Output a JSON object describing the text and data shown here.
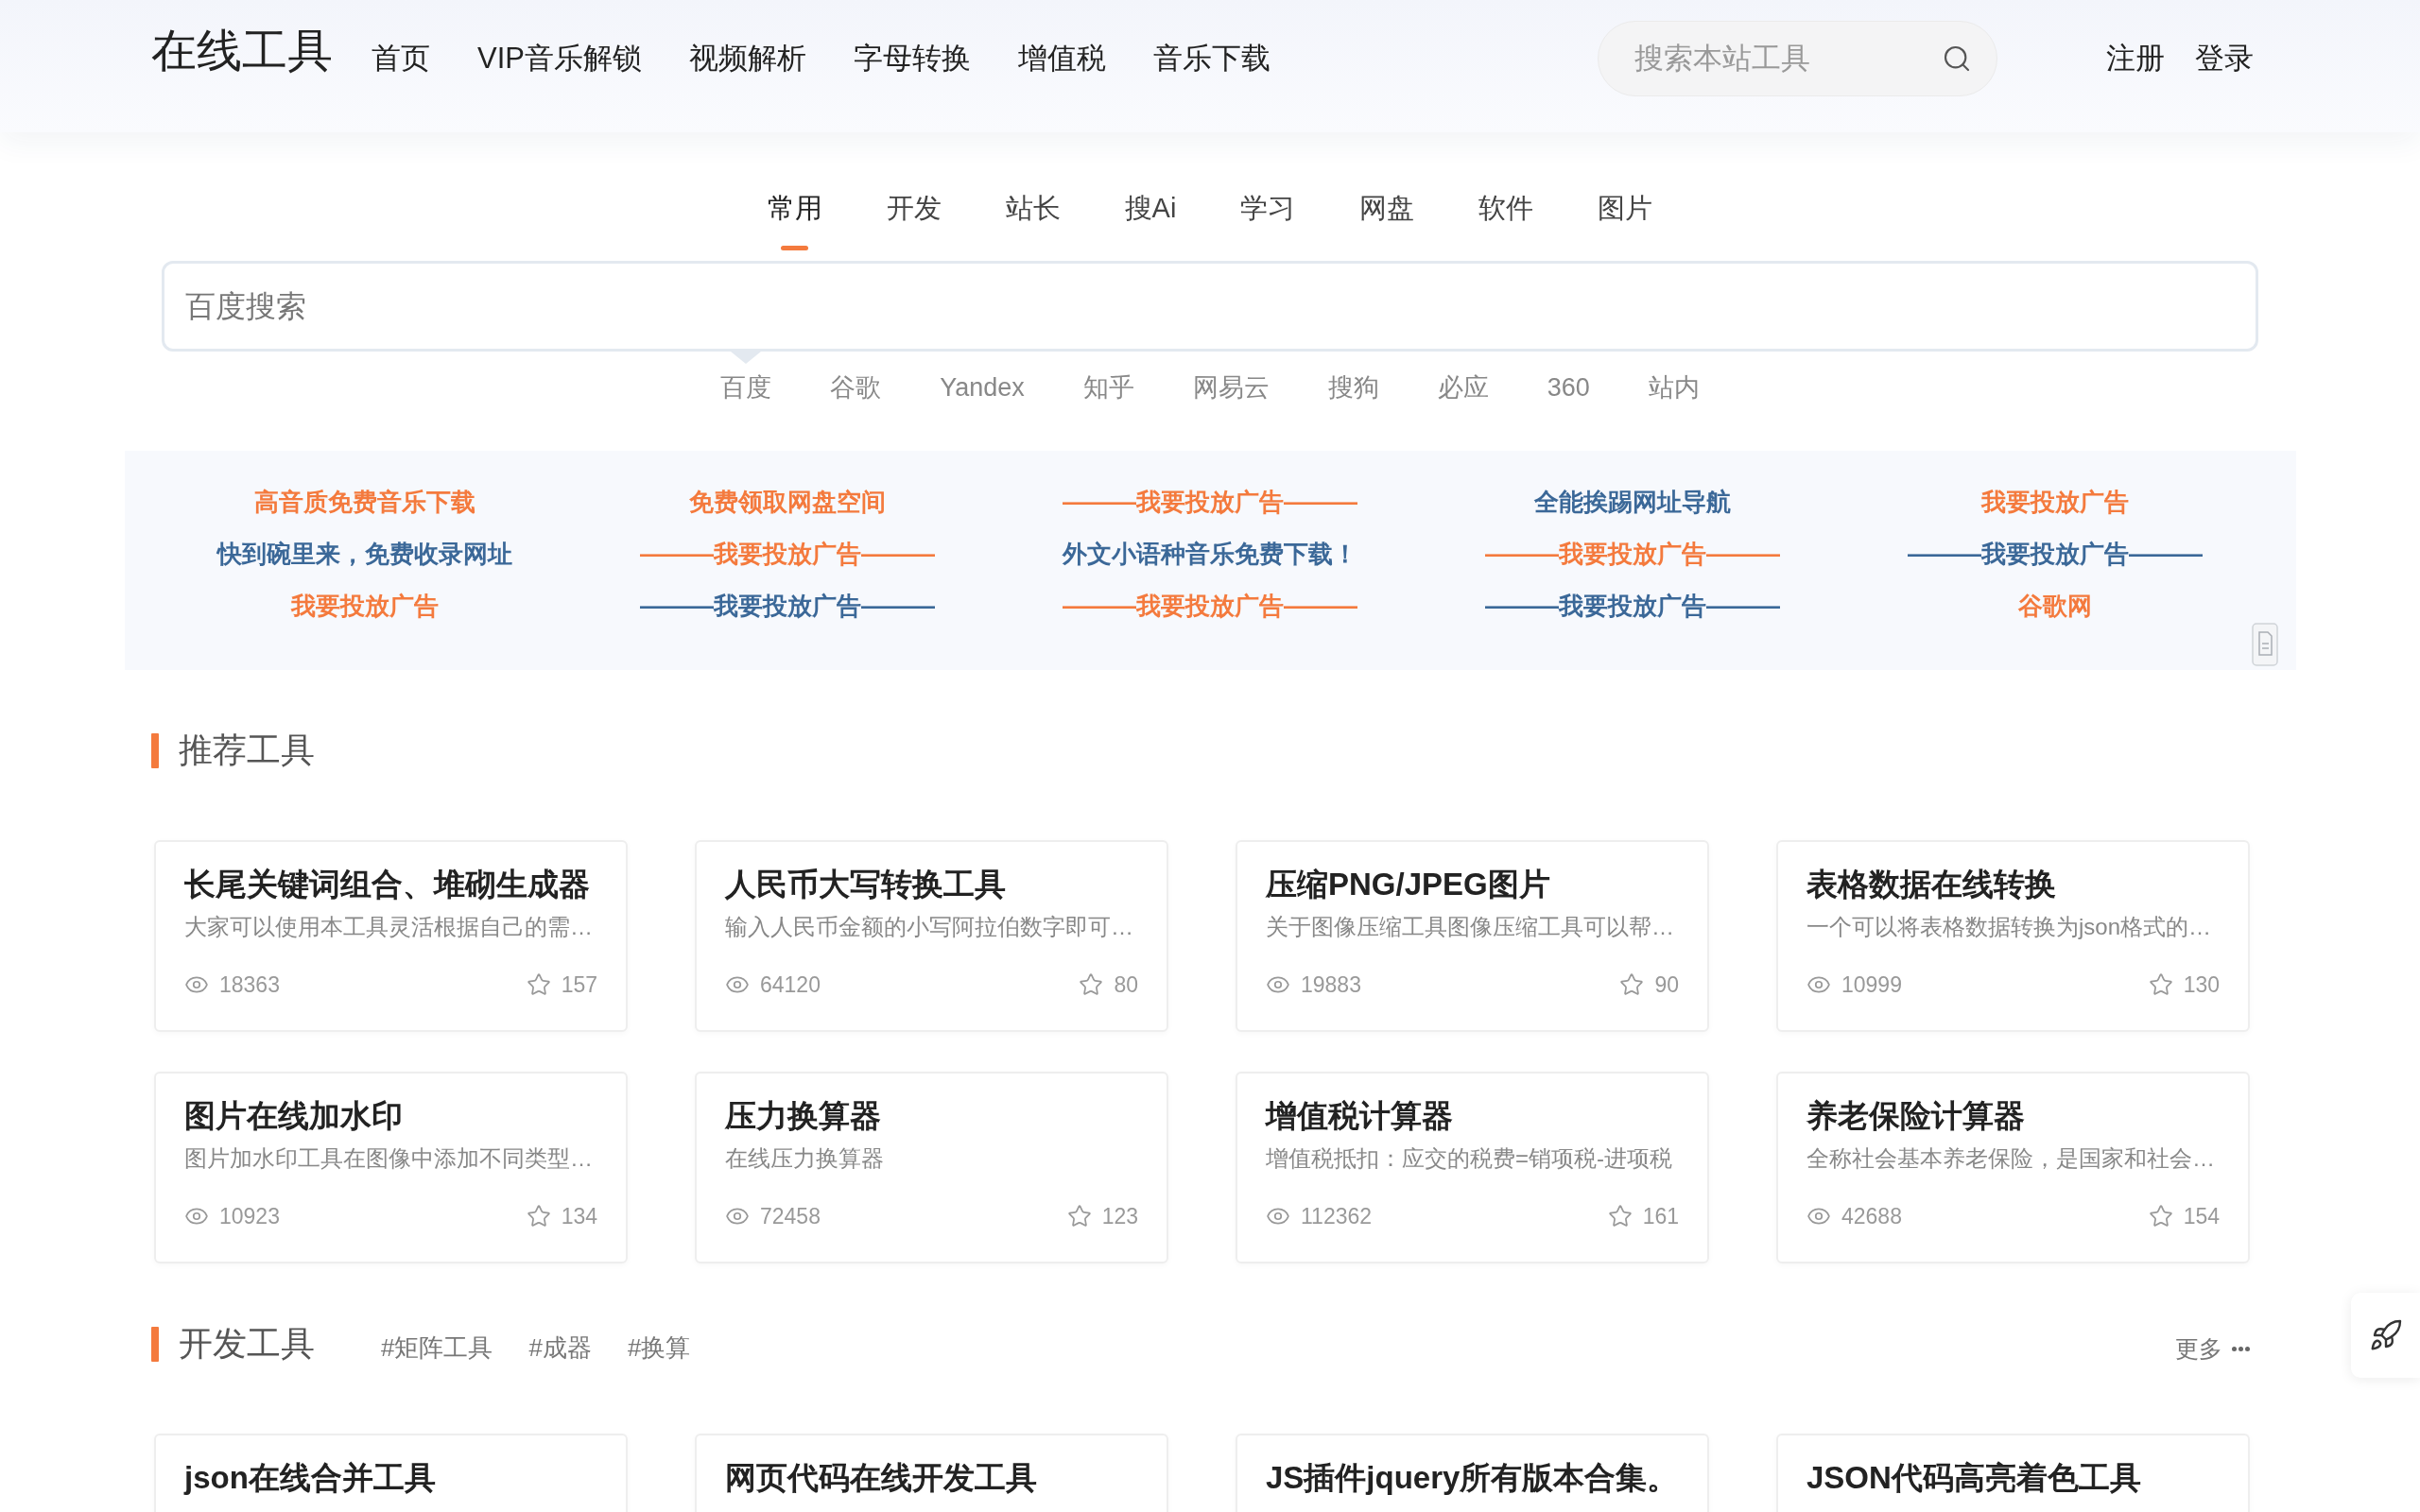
{
  "header": {
    "logo": "在线工具",
    "nav": [
      "首页",
      "VIP音乐解锁",
      "视频解析",
      "字母转换",
      "增值税",
      "音乐下载"
    ],
    "search": {
      "placeholder": "搜索本站工具"
    },
    "auth": [
      "注册",
      "登录"
    ]
  },
  "category_tabs": [
    {
      "label": "常用",
      "selected": true
    },
    {
      "label": "开发",
      "selected": false
    },
    {
      "label": "站长",
      "selected": false
    },
    {
      "label": "搜Ai",
      "selected": false
    },
    {
      "label": "学习",
      "selected": false
    },
    {
      "label": "网盘",
      "selected": false
    },
    {
      "label": "软件",
      "selected": false
    },
    {
      "label": "图片",
      "selected": false
    }
  ],
  "web_search": {
    "placeholder": "百度搜索",
    "engines": [
      {
        "label": "百度",
        "selected": true
      },
      {
        "label": "谷歌",
        "selected": false
      },
      {
        "label": "Yandex",
        "selected": false
      },
      {
        "label": "知乎",
        "selected": false
      },
      {
        "label": "网易云",
        "selected": false
      },
      {
        "label": "搜狗",
        "selected": false
      },
      {
        "label": "必应",
        "selected": false
      },
      {
        "label": "360",
        "selected": false
      },
      {
        "label": "站内",
        "selected": false
      }
    ]
  },
  "ad_links": [
    {
      "text": "高音质免费音乐下载",
      "color": "#f47a3d"
    },
    {
      "text": "免费领取网盘空间",
      "color": "#f47a3d"
    },
    {
      "text": "———我要投放广告———",
      "color": "#f47a3d"
    },
    {
      "text": "全能挨踢网址导航",
      "color": "#3b6898"
    },
    {
      "text": "我要投放广告",
      "color": "#f47a3d"
    },
    {
      "text": "快到碗里来，免费收录网址",
      "color": "#3b6898"
    },
    {
      "text": "———我要投放广告———",
      "color": "#f47a3d"
    },
    {
      "text": "外文小语种音乐免费下载！",
      "color": "#3b6898"
    },
    {
      "text": "———我要投放广告———",
      "color": "#f47a3d"
    },
    {
      "text": "———我要投放广告———",
      "color": "#3b6898"
    },
    {
      "text": "我要投放广告",
      "color": "#f47a3d"
    },
    {
      "text": "———我要投放广告———",
      "color": "#3b6898"
    },
    {
      "text": "———我要投放广告———",
      "color": "#f47a3d"
    },
    {
      "text": "———我要投放广告———",
      "color": "#3b6898"
    },
    {
      "text": "谷歌网",
      "color": "#f47a3d"
    }
  ],
  "sections": [
    {
      "title": "推荐工具",
      "cards": [
        {
          "title": "长尾关键词组合、堆砌生成器",
          "description": "大家可以使用本工具灵活根据自己的需…",
          "views": "18363",
          "favorites": "157"
        },
        {
          "title": "人民币大写转换工具",
          "description": "输入人民币金额的小写阿拉伯数字即可…",
          "views": "64120",
          "favorites": "80"
        },
        {
          "title": "压缩PNG/JPEG图片",
          "description": "关于图像压缩工具图像压缩工具可以帮…",
          "views": "19883",
          "favorites": "90"
        },
        {
          "title": "表格数据在线转换",
          "description": "一个可以将表格数据转换为json格式的…",
          "views": "10999",
          "favorites": "130"
        },
        {
          "title": "图片在线加水印",
          "description": "图片加水印工具在图像中添加不同类型…",
          "views": "10923",
          "favorites": "134"
        },
        {
          "title": "压力换算器",
          "description": "在线压力换算器",
          "views": "72458",
          "favorites": "123"
        },
        {
          "title": "增值税计算器",
          "description": "增值税抵扣：应交的税费=销项税-进项税",
          "views": "112362",
          "favorites": "161"
        },
        {
          "title": "养老保险计算器",
          "description": "全称社会基本养老保险，是国家和社会…",
          "views": "42688",
          "favorites": "154"
        }
      ]
    },
    {
      "title": "开发工具",
      "tags": [
        "#矩阵工具",
        "#成器",
        "#换算"
      ],
      "more": "更多",
      "cards": [
        {
          "title": "json在线合并工具"
        },
        {
          "title": "网页代码在线开发工具"
        },
        {
          "title": "JS插件jquery所有版本合集。"
        },
        {
          "title": "JSON代码高亮着色工具"
        }
      ]
    }
  ]
}
